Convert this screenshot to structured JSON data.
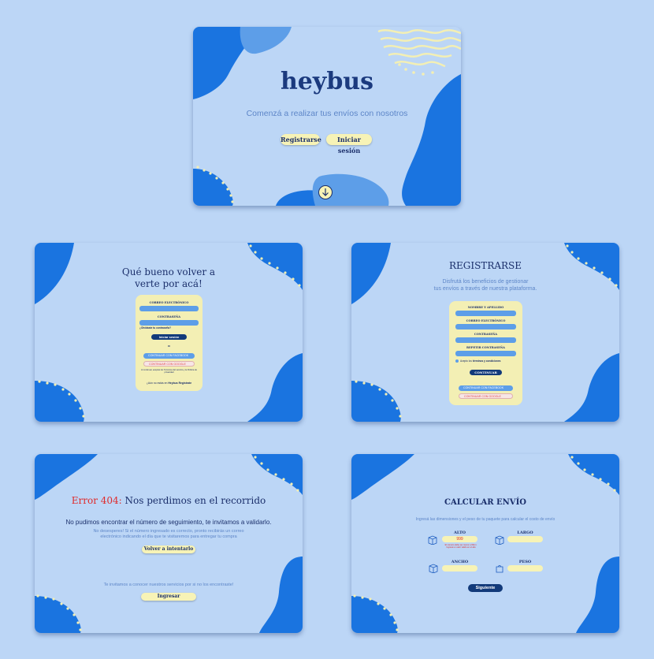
{
  "landing": {
    "logo": "heybus",
    "tagline": "Comenzá a realizar tus envíos con nosotros",
    "register_button": "Registrarse",
    "login_button": "Iniciar sesión",
    "scroll_icon": "arrow-down-icon"
  },
  "login": {
    "heading_line1": "Qué bueno volver a",
    "heading_line2": "verte por acá!",
    "email_label": "CORREO ELECTRÓNICO",
    "password_label": "CONTRASEÑA",
    "forgot_password": "¿Olvidaste tu contraseña?",
    "submit": "Iniciar sesión",
    "or": "o",
    "facebook": "CONTINUAR CON FACEBOOK",
    "google": "CONTINUAR CON GOOGLE",
    "terms": "Al continuar, aceptás los Términos del servicio y la Política de privacidad",
    "no_account": "¿Aún no estás en",
    "brand": "Heybus",
    "register_link": "Registrate"
  },
  "register": {
    "heading": "REGISTRARSE",
    "subtitle_line1": "Disfrutá los beneficios de gestionar",
    "subtitle_line2": "tus envíos a través de nuestra plataforma.",
    "name_label": "NOMBRE Y APELLIDO",
    "email_label": "CORREO ELECTRÓNICO",
    "password_label": "CONTRASEÑA",
    "repeat_password_label": "REPETIR CONTRASEÑA",
    "terms_text": "Acepto los",
    "terms_link": "términos y condiciones",
    "submit": "CONTINUAR",
    "facebook": "CONTINUAR CON FACEBOOK",
    "google": "CONTINUAR CON GOOGLE"
  },
  "error404": {
    "error_code": "Error 404:",
    "heading": "Nos perdimos en el recorrido",
    "message": "No pudimos encontrar el número de seguimiento, te invitamos a validarlo.",
    "detail_line1": "No desesperes! Si el número ingresado es correcto, pronto recibirás un correo",
    "detail_line2": "electrónico indicando el día que te visitaremos para entregar tu compra",
    "retry_button": "Volver a intentarlo",
    "invite": "Te invitamos a conocer nuestros servicios por si no los encontraste!",
    "login_button": "Ingresar"
  },
  "calculator": {
    "heading": "CALCULAR ENVÍO",
    "instructions": "Ingresá las dimensiones y el peso de tu paquete para calcular el costo de envío",
    "height_label": "ALTO",
    "height_value": "999",
    "height_error": "El número debe ser menor a 99cm. Ingresá un valor válido en el alto",
    "length_label": "LARGO",
    "width_label": "ANCHO",
    "weight_label": "PESO",
    "next_button": "Siguiente"
  },
  "colors": {
    "background": "#bcd6f6",
    "blob_primary": "#1a74e0",
    "blob_secondary": "#5d9ee8",
    "cream": "#f7f3b6",
    "navy": "#1b2f6b",
    "error_red": "#e02a2a"
  }
}
